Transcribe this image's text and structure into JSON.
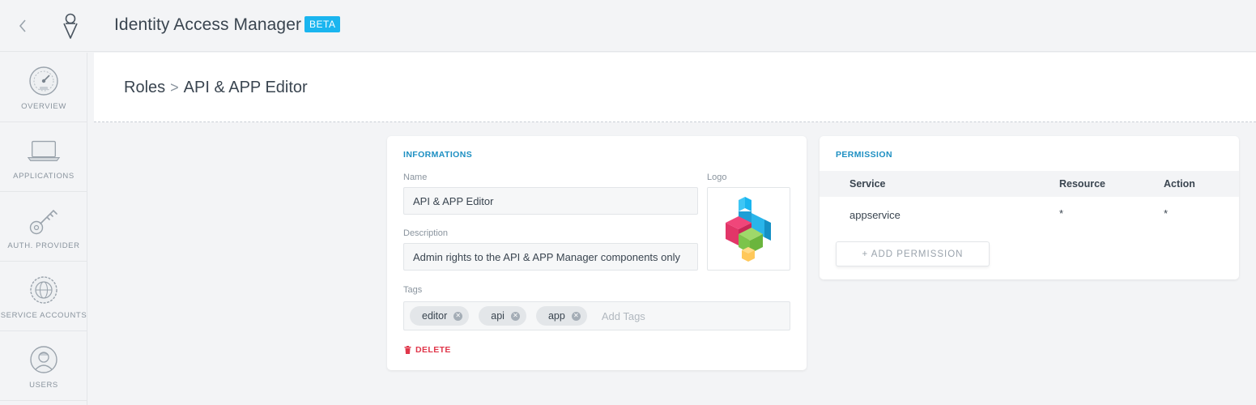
{
  "topbar": {
    "app_title": "Identity Access Manager",
    "beta_label": "BETA",
    "accent_color": "#1ab5ef"
  },
  "sidebar": {
    "items": [
      {
        "label": "OVERVIEW",
        "icon": "speedometer-icon"
      },
      {
        "label": "APPLICATIONS",
        "icon": "laptop-icon"
      },
      {
        "label": "AUTH. PROVIDER",
        "icon": "key-icon"
      },
      {
        "label": "SERVICE ACCOUNTS",
        "icon": "globe-gear-icon"
      },
      {
        "label": "USERS",
        "icon": "user-avatar-icon"
      }
    ]
  },
  "breadcrumb": {
    "parent": "Roles",
    "separator": ">",
    "current": "API & APP Editor"
  },
  "info": {
    "title": "INFORMATIONS",
    "name_label": "Name",
    "name_value": "API & APP Editor",
    "description_label": "Description",
    "description_value": "Admin rights to the API & APP Manager components only",
    "logo_label": "Logo",
    "tags_label": "Tags",
    "tags": [
      "editor",
      "api",
      "app"
    ],
    "tags_placeholder": "Add Tags",
    "delete_label": "DELETE",
    "delete_color": "#e0364a"
  },
  "permission": {
    "title": "PERMISSION",
    "columns": [
      "Service",
      "Resource",
      "Action"
    ],
    "rows": [
      {
        "service": "appservice",
        "resource": "*",
        "action": "*"
      }
    ],
    "add_label": "+ ADD PERMISSION",
    "title_color": "#1d8fc2"
  }
}
